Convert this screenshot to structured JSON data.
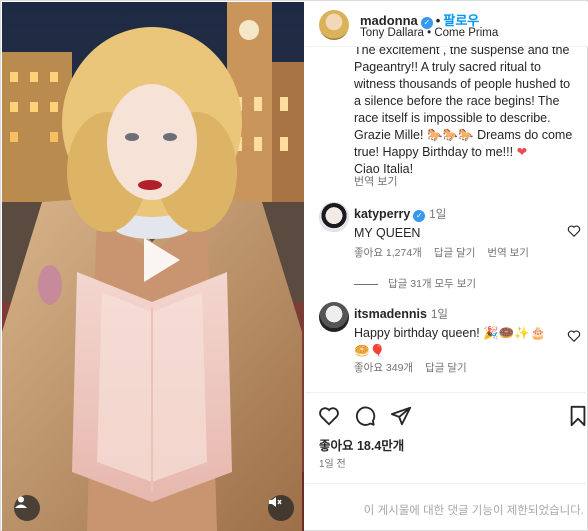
{
  "header": {
    "username": "madonna",
    "verified_mark": "✓",
    "separator": "•",
    "follow_label": "팔로우",
    "subtitle": "Tony Dallara • Come Prima"
  },
  "caption": {
    "text": "The excitement , the suspense and the Pageantry!! A truly sacred ritual to witness  thousands of people hushed to a silence before the race begins!  The race itself is impossible to describe. Grazie Mille! ",
    "mid_text": " Dreams do come true! Happy Birthday to me!!!",
    "emoji_horses": "🐎🐎🐎",
    "heart": "❤",
    "closing": "Ciao Italia!",
    "translate": "번역 보기"
  },
  "comments": [
    {
      "username": "katyperry",
      "time": "1일",
      "text": "MY QUEEN",
      "likes": "좋아요 1,274개",
      "reply": "답글 달기",
      "translate": "번역 보기",
      "view_replies": "답글 31개 모두 보기"
    },
    {
      "username": "itsmadennis",
      "time": "1일",
      "text": "Happy birthday queen! 🎉🍩✨🎂🥯🎈",
      "likes": "좋아요 349개",
      "reply": "답글 달기"
    }
  ],
  "post": {
    "likes": "좋아요 18.4만개",
    "posted": "1일 전",
    "comments_disabled": "이 게시물에 대한 댓글 기능이 제한되었습니다."
  },
  "icons": {
    "heart": "heart-icon",
    "comment": "comment-icon",
    "share": "share-icon",
    "bookmark": "bookmark-icon",
    "play": "play-icon",
    "user_tag": "user-icon",
    "mute": "mute-icon"
  }
}
